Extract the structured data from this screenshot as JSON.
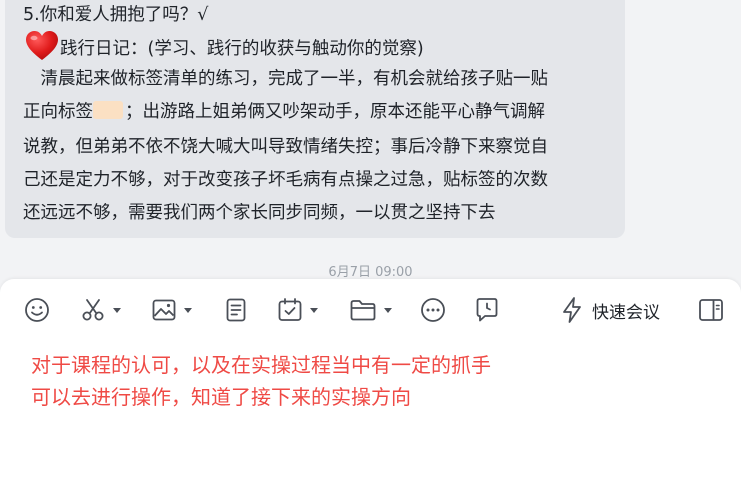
{
  "chat": {
    "lines": [
      "5.你和爱人拥抱了吗？√",
      "践行日记：(学习、践行的收获与触动你的觉察)",
      "　清晨起来做标签清单的练习，完成了一半，有机会就给孩子贴一贴",
      "正向标签",
      "；出游路上姐弟俩又吵架动手，原本还能平心静气调解",
      "说教，但弟弟不依不饶大喊大叫导致情绪失控；事后冷静下来察觉自",
      "己还是定力不够，对于改变孩子坏毛病有点操之过急，贴标签的次数",
      "还远远不够，需要我们两个家长同步同频，一以贯之坚持下去"
    ],
    "heart_icon": "red-heart-emoji",
    "tag_icon": "label-tag-emoji",
    "timestamp": "6月7日 09:00"
  },
  "toolbar": {
    "emoji_icon": "smiley-icon",
    "cut_icon": "scissors-icon",
    "image_icon": "image-icon",
    "doc_icon": "document-icon",
    "task_icon": "calendar-check-icon",
    "folder_icon": "folder-icon",
    "more_icon": "more-dots-icon",
    "schedule_icon": "clock-chat-icon",
    "quick_meeting_label": "快速会议",
    "quick_meeting_icon": "lightning-icon",
    "panel_icon": "split-panel-icon"
  },
  "editor": {
    "lines": [
      "对于课程的认可，以及在实操过程当中有一定的抓手",
      "可以去进行操作，知道了接下来的实操方向"
    ],
    "text_color": "#ef4a45"
  }
}
